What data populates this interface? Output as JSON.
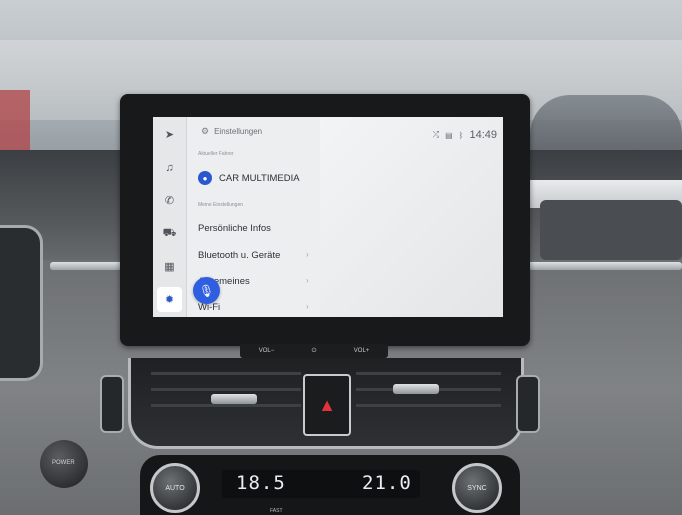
{
  "screen": {
    "status_time": "14:49",
    "settings_title": "Einstellungen",
    "section_current_driver": "Aktueller Fahrer",
    "driver_name": "CAR MULTIMEDIA",
    "section_my_settings": "Meine Einstellungen",
    "menu_items": [
      {
        "label": "Persönliche Infos"
      },
      {
        "label": "Bluetooth u. Geräte"
      },
      {
        "label": "Allgemeines"
      },
      {
        "label": "Wi-Fi"
      }
    ],
    "rail_icons": [
      "navigation-icon",
      "music-icon",
      "phone-icon",
      "car-icon",
      "apps-icon",
      "settings-icon"
    ],
    "accent_color": "#2a57d0"
  },
  "controls": {
    "vol_down": "VOL−",
    "power": "⏻",
    "vol_up": "VOL+"
  },
  "climate": {
    "left_button": "AUTO",
    "right_button": "SYNC",
    "left_temp": "18.5",
    "right_temp": "21.0",
    "fast_label": "FAST",
    "power_label": "POWER"
  }
}
